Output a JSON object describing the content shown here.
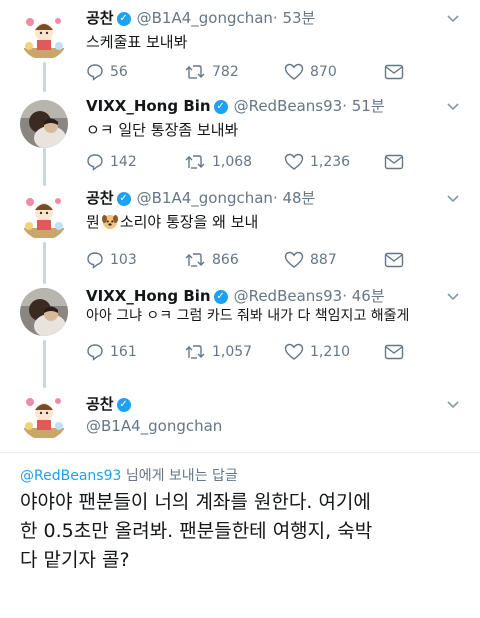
{
  "tweets": [
    {
      "name": "공찬",
      "verified": true,
      "handle": "@B1A4_gongchan",
      "time": "· 53분",
      "text": "스케줄표 보내봐",
      "replies": "56",
      "retweets": "782",
      "likes": "870",
      "avatar": "cartoon"
    },
    {
      "name": "VIXX_Hong Bin",
      "verified": true,
      "handle": "@RedBeans93",
      "time": "· 51분",
      "text": "ㅇㅋ 일단 통장좀 보내봐",
      "replies": "142",
      "retweets": "1,068",
      "likes": "1,236",
      "avatar": "photo"
    },
    {
      "name": "공찬",
      "verified": true,
      "handle": "@B1A4_gongchan",
      "time": "· 48분",
      "text_before": "뭔",
      "emoji": "dog-face",
      "text_after": "소리야 통장을 왜 보내",
      "replies": "103",
      "retweets": "866",
      "likes": "887",
      "avatar": "cartoon"
    },
    {
      "name": "VIXX_Hong Bin",
      "verified": true,
      "handle": "@RedBeans93",
      "time": "· 46분",
      "text": "아아 그냐 ㅇㅋ 그럼 카드 줘봐 내가 다 책임지고 해줄게",
      "replies": "161",
      "retweets": "1,057",
      "likes": "1,210",
      "avatar": "photo"
    }
  ],
  "current": {
    "name": "공찬",
    "verified": true,
    "handle": "@B1A4_gongchan"
  },
  "reply_context": {
    "mention": "@RedBeans93",
    "suffix": " 님에게 보내는 답글"
  },
  "compose_lines": [
    "야야야 팬분들이 너의 계좌를 원한다. 여기에",
    "한 0.5초만 올려봐. 팬분들한테 여행지, 숙박",
    "다 맡기자 콜?"
  ],
  "colors": {
    "accent": "#1da1f2",
    "muted": "#657786",
    "text": "#14171a"
  }
}
